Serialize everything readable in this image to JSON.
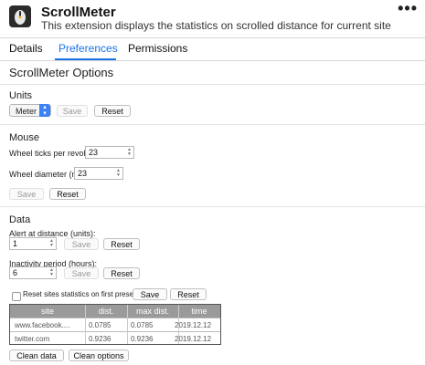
{
  "extension": {
    "name": "ScrollMeter",
    "description": "This extension displays the statistics on scrolled distance for current site",
    "more_icon": "ellipsis-icon",
    "more_label": "•••",
    "icon": "scrollmeter-logo-icon"
  },
  "tabs": [
    {
      "label": "Details",
      "active": false
    },
    {
      "label": "Preferences",
      "active": true
    },
    {
      "label": "Permissions",
      "active": false
    }
  ],
  "options": {
    "title": "ScrollMeter Options",
    "units": {
      "heading": "Units",
      "select_value": "Meter",
      "save_label": "Save",
      "reset_label": "Reset"
    },
    "mouse": {
      "heading": "Mouse",
      "wheel_ticks_label": "Wheel ticks per revolution:",
      "wheel_ticks_value": "23",
      "wheel_diameter_label": "Wheel diameter (mm):",
      "wheel_diameter_value": "23",
      "save_label": "Save",
      "reset_label": "Reset"
    },
    "data": {
      "heading": "Data",
      "alert_label": "Alert at distance (units):",
      "alert_value": "1",
      "alert_save": "Save",
      "alert_reset": "Reset",
      "inactivity_label": "Inactivity period (hours):",
      "inactivity_value": "6",
      "inactivity_save": "Save",
      "inactivity_reset": "Reset",
      "reset_first_presence_label": "Reset sites statistics on first presence",
      "reset_first_presence_checked": false,
      "presence_save": "Save",
      "presence_reset": "Reset"
    }
  },
  "stats_table": {
    "columns": [
      "site",
      "dist.",
      "max dist.",
      "time"
    ],
    "rows": [
      [
        "www.facebook....",
        "0.0785",
        "0.0785",
        "2019.12.12"
      ],
      [
        "twitter.com",
        "0.9236",
        "0.9236",
        "2019.12.12"
      ]
    ]
  },
  "footer": {
    "clean_data_label": "Clean data",
    "clean_options_label": "Clean options"
  },
  "colors": {
    "accent": "#1a73e8",
    "table_header": "#9a9a9a",
    "select_arrow": "#3b82f6"
  }
}
